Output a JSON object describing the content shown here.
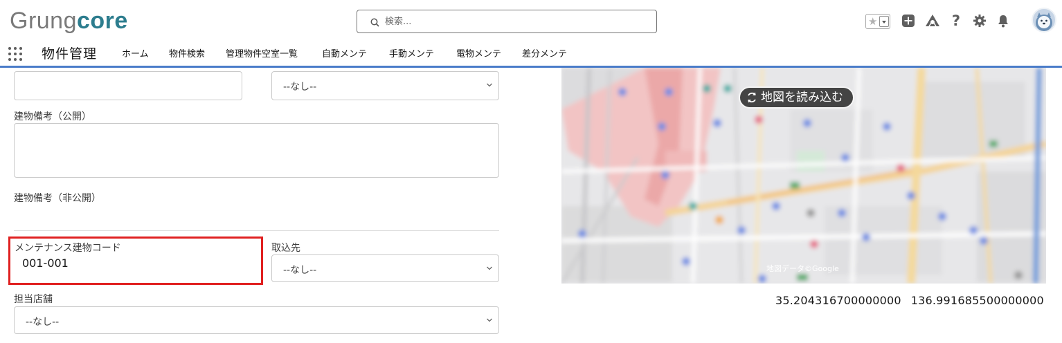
{
  "header": {
    "logo_part1": "Grung",
    "logo_part2": "core",
    "search_placeholder": "検索...",
    "icons": [
      "favorites-star-icon",
      "favorites-dropdown-icon",
      "add-icon",
      "trailhead-icon",
      "help-icon",
      "setup-gear-icon",
      "notifications-bell-icon",
      "user-avatar-icon"
    ]
  },
  "nav": {
    "app_name": "物件管理",
    "items": [
      "ホーム",
      "物件検索",
      "管理物件空室一覧",
      "自動メンテ",
      "手動メンテ",
      "電物メンテ",
      "差分メンテ"
    ]
  },
  "form": {
    "top_select_value": "--なし--",
    "label_building_note_public": "建物備考（公開）",
    "label_building_note_private": "建物備考（非公開）",
    "label_maintenance_code": "メンテナンス建物コード",
    "maintenance_code_value": "001-001",
    "label_import_source": "取込先",
    "import_source_value": "--なし--",
    "label_store": "担当店舗",
    "store_value": "--なし--"
  },
  "map": {
    "load_button_label": "地図を読み込む",
    "credit": "地図データ©Google",
    "latitude": "35.204316700000000",
    "longitude": "136.991685500000000"
  },
  "colors": {
    "brand_teal": "#2d7d8e",
    "nav_underline": "#4a7cc9",
    "highlight_red": "#e02020"
  }
}
